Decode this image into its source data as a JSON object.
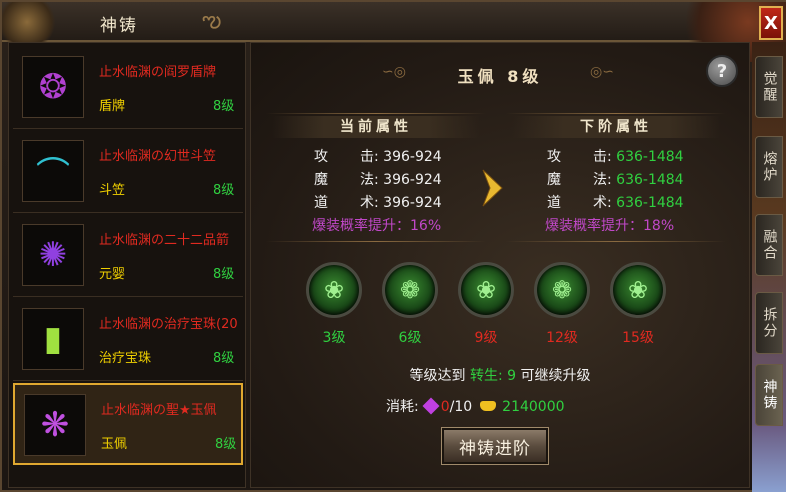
{
  "window": {
    "title": "神铸",
    "close_glyph": "X"
  },
  "items": [
    {
      "name": "止水临渊の阎罗盾牌",
      "type": "盾牌",
      "level": "8级",
      "icon": "shield-icon",
      "glyph": "❂",
      "color": "#b040d0",
      "selected": false
    },
    {
      "name": "止水临渊の幻世斗笠",
      "type": "斗笠",
      "level": "8级",
      "icon": "hat-icon",
      "glyph": "⌒",
      "color": "#30c0d0",
      "selected": false
    },
    {
      "name": "止水临渊の二十二品箭",
      "type": "元婴",
      "level": "8级",
      "icon": "spirit-icon",
      "glyph": "✺",
      "color": "#9040e0",
      "selected": false
    },
    {
      "name": "止水临渊の治疗宝珠(20",
      "type": "治疗宝珠",
      "level": "8级",
      "icon": "potion-icon",
      "glyph": "▮",
      "color": "#a0e040",
      "selected": false
    },
    {
      "name": "止水临渊の聖★玉佩",
      "type": "玉佩",
      "level": "8级",
      "icon": "pendant-icon",
      "glyph": "❋",
      "color": "#c050e0",
      "selected": true
    }
  ],
  "main": {
    "heading": "玉佩 8级",
    "help_glyph": "?",
    "current": {
      "header": "当前属性",
      "rows": [
        {
          "label": "攻",
          "label2": "击",
          "value": "396-924"
        },
        {
          "label": "魔",
          "label2": "法",
          "value": "396-924"
        },
        {
          "label": "道",
          "label2": "术",
          "value": "396-924"
        }
      ],
      "bonus": "爆装概率提升：16%"
    },
    "next": {
      "header": "下阶属性",
      "rows": [
        {
          "label": "攻",
          "label2": "击",
          "value": "636-1484"
        },
        {
          "label": "魔",
          "label2": "法",
          "value": "636-1484"
        },
        {
          "label": "道",
          "label2": "术",
          "value": "636-1484"
        }
      ],
      "bonus": "爆装概率提升：18%"
    },
    "stages": [
      {
        "label": "3级",
        "color": "#30d040"
      },
      {
        "label": "6级",
        "color": "#30d040"
      },
      {
        "label": "9级",
        "color": "#e02a20"
      },
      {
        "label": "12级",
        "color": "#e02a20"
      },
      {
        "label": "15级",
        "color": "#e02a20"
      }
    ],
    "requirement": {
      "prefix": "等级达到 ",
      "key": "转生: ",
      "value": "9",
      "suffix": " 可继续升级"
    },
    "cost": {
      "label": "消耗:",
      "gem_have": "0",
      "gem_need": "/10",
      "gold": "2140000"
    },
    "forge_button": "神铸进阶"
  },
  "side_tabs": [
    {
      "label": "觉醒",
      "active": false
    },
    {
      "label": "熔炉",
      "active": false
    },
    {
      "label": "融合",
      "active": false
    },
    {
      "label": "拆分",
      "active": false
    },
    {
      "label": "神铸",
      "active": true
    }
  ]
}
